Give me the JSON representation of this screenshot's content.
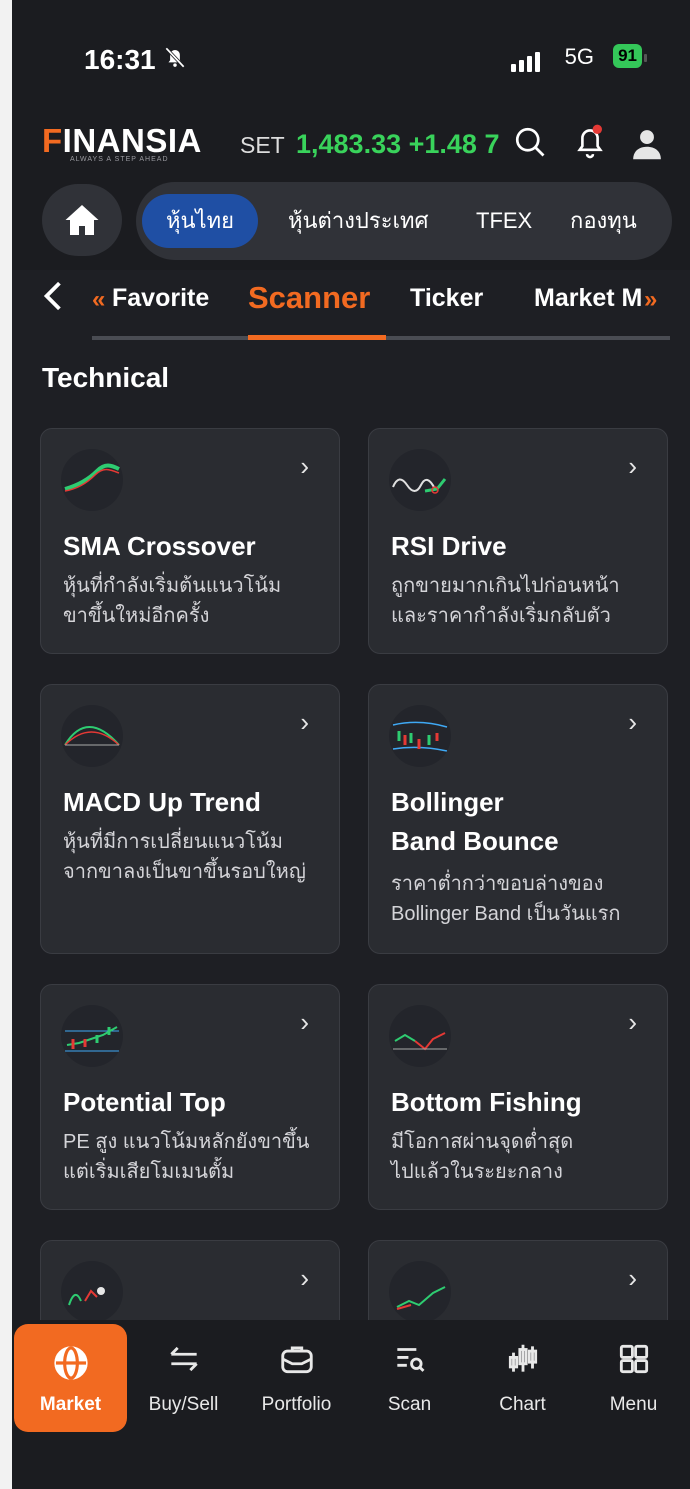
{
  "status_bar": {
    "time": "16:31",
    "network": "5G",
    "battery": "91"
  },
  "header": {
    "logo": "FINANSIA",
    "tagline": "ALWAYS A STEP AHEAD",
    "index_label": "SET",
    "index_value": "1,483.33",
    "index_change": "+1.48",
    "index_pct_partial": "7"
  },
  "market_tabs": [
    "หุ้นไทย",
    "หุ้นต่างประเทศ",
    "TFEX",
    "กองทุน"
  ],
  "sub_tabs": {
    "favorite": "Favorite",
    "scanner": "Scanner",
    "ticker": "Ticker",
    "market": "Market M"
  },
  "section": {
    "title": "Technical"
  },
  "cards": [
    {
      "title": "SMA Crossover",
      "desc1": "หุ้นที่กำลังเริ่มต้นแนวโน้ม",
      "desc2": "ขาขึ้นใหม่อีกครั้ง"
    },
    {
      "title": "RSI Drive",
      "desc1": "ถูกขายมากเกินไปก่อนหน้า",
      "desc2": "และราคากำลังเริ่มกลับตัว"
    },
    {
      "title": "MACD Up Trend",
      "desc1": "หุ้นที่มีการเปลี่ยนแนวโน้ม",
      "desc2": "จากขาลงเป็นขาขึ้นรอบใหญ่"
    },
    {
      "title": "Bollinger",
      "title2": "Band Bounce",
      "desc1": "ราคาต่ำกว่าขอบล่างของ",
      "desc2": "Bollinger Band เป็นวันแรก"
    },
    {
      "title": "Potential Top",
      "desc1": "PE สูง แนวโน้มหลักยังขาขึ้น",
      "desc2": "แต่เริ่มเสียโมเมนตั้ม"
    },
    {
      "title": "Bottom Fishing",
      "desc1": "มีโอกาสผ่านจุดต่ำสุด",
      "desc2": "ไปแล้วในระยะกลาง"
    }
  ],
  "bottom_nav": [
    {
      "label": "Market",
      "icon": "globe-icon"
    },
    {
      "label": "Buy/Sell",
      "icon": "swap-arrows-icon"
    },
    {
      "label": "Portfolio",
      "icon": "briefcase-icon"
    },
    {
      "label": "Scan",
      "icon": "scan-list-icon"
    },
    {
      "label": "Chart",
      "icon": "candlestick-icon"
    },
    {
      "label": "Menu",
      "icon": "grid-menu-icon"
    }
  ],
  "colors": {
    "accent": "#f26a21",
    "positive": "#39d35b",
    "active_tab": "#1f4fa4",
    "background": "#1e1f24",
    "card": "#2a2c31"
  }
}
